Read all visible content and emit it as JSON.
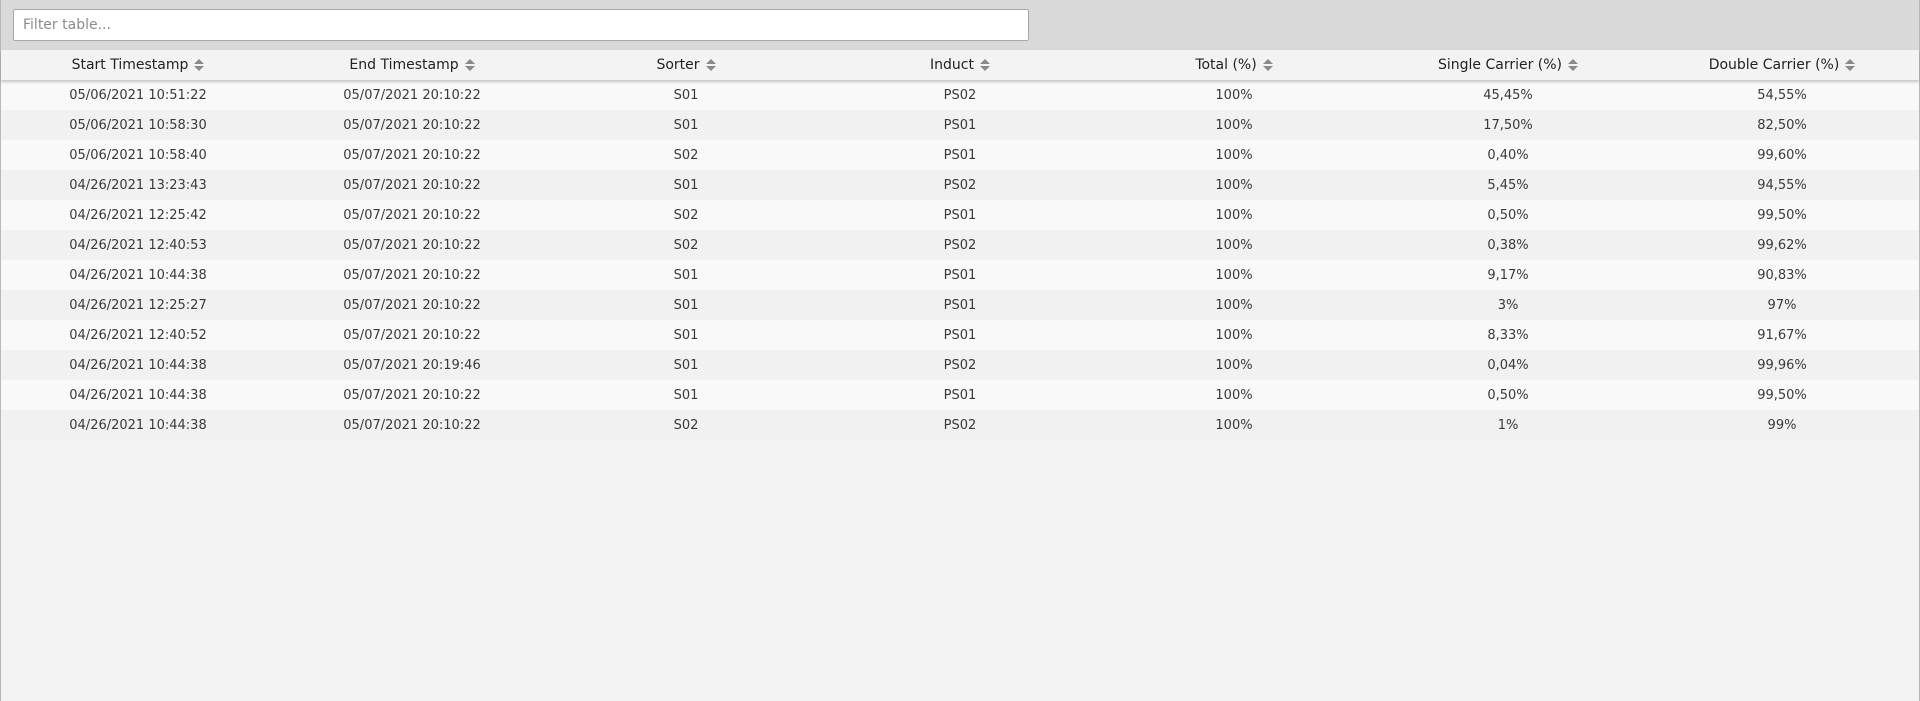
{
  "filter": {
    "placeholder": "Filter table...",
    "value": ""
  },
  "table": {
    "columns": [
      "Start Timestamp",
      "End Timestamp",
      "Sorter",
      "Induct",
      "Total (%)",
      "Single Carrier (%)",
      "Double Carrier (%)"
    ],
    "rows": [
      [
        "05/06/2021 10:51:22",
        "05/07/2021 20:10:22",
        "S01",
        "PS02",
        "100%",
        "45,45%",
        "54,55%"
      ],
      [
        "05/06/2021 10:58:30",
        "05/07/2021 20:10:22",
        "S01",
        "PS01",
        "100%",
        "17,50%",
        "82,50%"
      ],
      [
        "05/06/2021 10:58:40",
        "05/07/2021 20:10:22",
        "S02",
        "PS01",
        "100%",
        "0,40%",
        "99,60%"
      ],
      [
        "04/26/2021 13:23:43",
        "05/07/2021 20:10:22",
        "S01",
        "PS02",
        "100%",
        "5,45%",
        "94,55%"
      ],
      [
        "04/26/2021 12:25:42",
        "05/07/2021 20:10:22",
        "S02",
        "PS01",
        "100%",
        "0,50%",
        "99,50%"
      ],
      [
        "04/26/2021 12:40:53",
        "05/07/2021 20:10:22",
        "S02",
        "PS02",
        "100%",
        "0,38%",
        "99,62%"
      ],
      [
        "04/26/2021 10:44:38",
        "05/07/2021 20:10:22",
        "S01",
        "PS01",
        "100%",
        "9,17%",
        "90,83%"
      ],
      [
        "04/26/2021 12:25:27",
        "05/07/2021 20:10:22",
        "S01",
        "PS01",
        "100%",
        "3%",
        "97%"
      ],
      [
        "04/26/2021 12:40:52",
        "05/07/2021 20:10:22",
        "S01",
        "PS01",
        "100%",
        "8,33%",
        "91,67%"
      ],
      [
        "04/26/2021 10:44:38",
        "05/07/2021 20:19:46",
        "S01",
        "PS02",
        "100%",
        "0,04%",
        "99,96%"
      ],
      [
        "04/26/2021 10:44:38",
        "05/07/2021 20:10:22",
        "S01",
        "PS01",
        "100%",
        "0,50%",
        "99,50%"
      ],
      [
        "04/26/2021 10:44:38",
        "05/07/2021 20:10:22",
        "S02",
        "PS02",
        "100%",
        "1%",
        "99%"
      ]
    ]
  }
}
